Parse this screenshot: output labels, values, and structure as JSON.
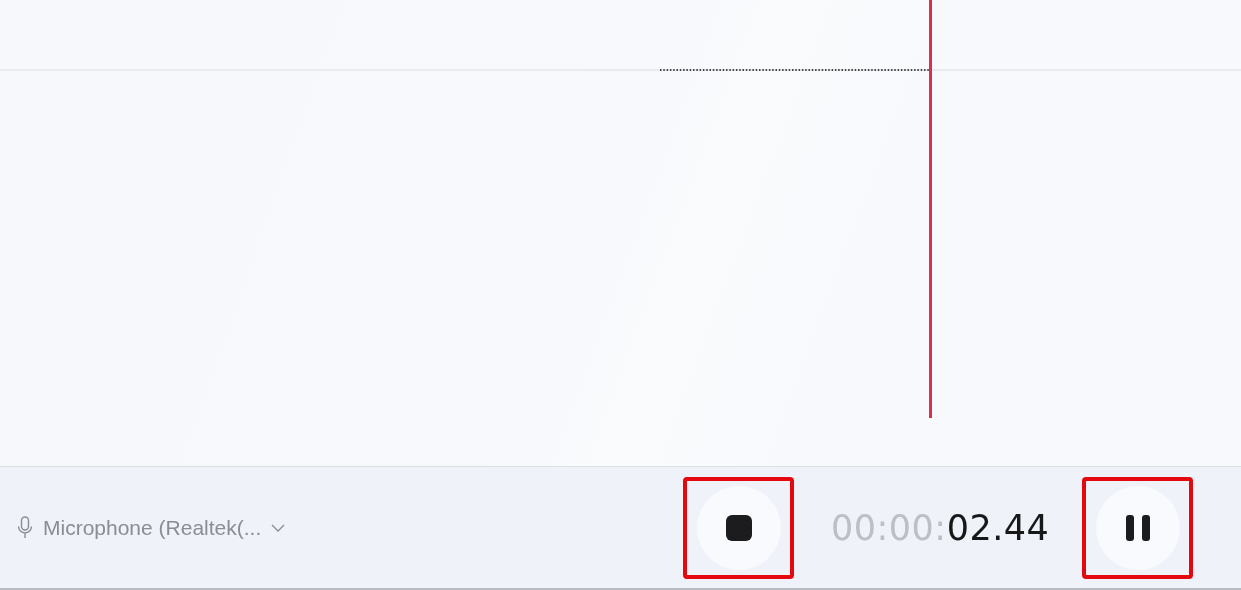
{
  "input_device": {
    "label": "Microphone (Realtek(..."
  },
  "timer": {
    "elapsed_dim": "00:00:",
    "elapsed": "02.44"
  },
  "controls": [
    {
      "kind": "stop",
      "highlighted": true
    },
    {
      "kind": "pause",
      "highlighted": true
    }
  ]
}
